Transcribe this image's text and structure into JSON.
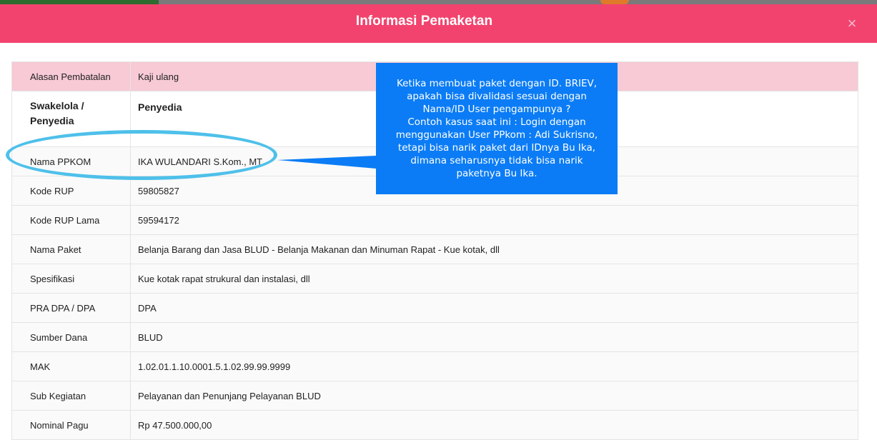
{
  "modal": {
    "title": "Informasi Pemaketan",
    "close_label": "×"
  },
  "rows": [
    {
      "label": "Alasan Pembatalan",
      "value": "Kaji ulang"
    },
    {
      "label": "Swakelola / Penyedia",
      "value": "Penyedia"
    },
    {
      "label": "Nama PPKOM",
      "value": "IKA WULANDARI S.Kom., MT."
    },
    {
      "label": "Kode RUP",
      "value": "59805827"
    },
    {
      "label": "Kode RUP Lama",
      "value": "59594172"
    },
    {
      "label": "Nama Paket",
      "value": "Belanja Barang dan Jasa BLUD - Belanja Makanan dan Minuman Rapat - Kue kotak, dll"
    },
    {
      "label": "Spesifikasi",
      "value": "Kue kotak rapat strukural dan instalasi, dll"
    },
    {
      "label": "PRA DPA / DPA",
      "value": "DPA"
    },
    {
      "label": "Sumber Dana",
      "value": "BLUD"
    },
    {
      "label": "MAK",
      "value": "1.02.01.1.10.0001.5.1.02.99.99.9999"
    },
    {
      "label": "Sub Kegiatan",
      "value": "Pelayanan dan Penunjang Pelayanan BLUD"
    },
    {
      "label": "Nominal Pagu",
      "value": "Rp 47.500.000,00"
    }
  ],
  "annotation": {
    "lines": [
      "Ketika membuat paket dengan ID. BRIEV,",
      "apakah bisa divalidasi sesuai dengan",
      "Nama/ID User pengampunya ?",
      "Contoh kasus saat ini : Login dengan",
      "menggunakan User PPkom : Adi Sukrisno,",
      "tetapi bisa narik paket  dari IDnya Bu Ika,",
      "dimana seharusnya tidak bisa narik",
      "paketnya Bu Ika."
    ],
    "box_color": "#0b7cf5",
    "ellipse_color": "#4ec0ea"
  },
  "colors": {
    "header": "#f2436e",
    "highlight_row": "#f7cad5"
  }
}
